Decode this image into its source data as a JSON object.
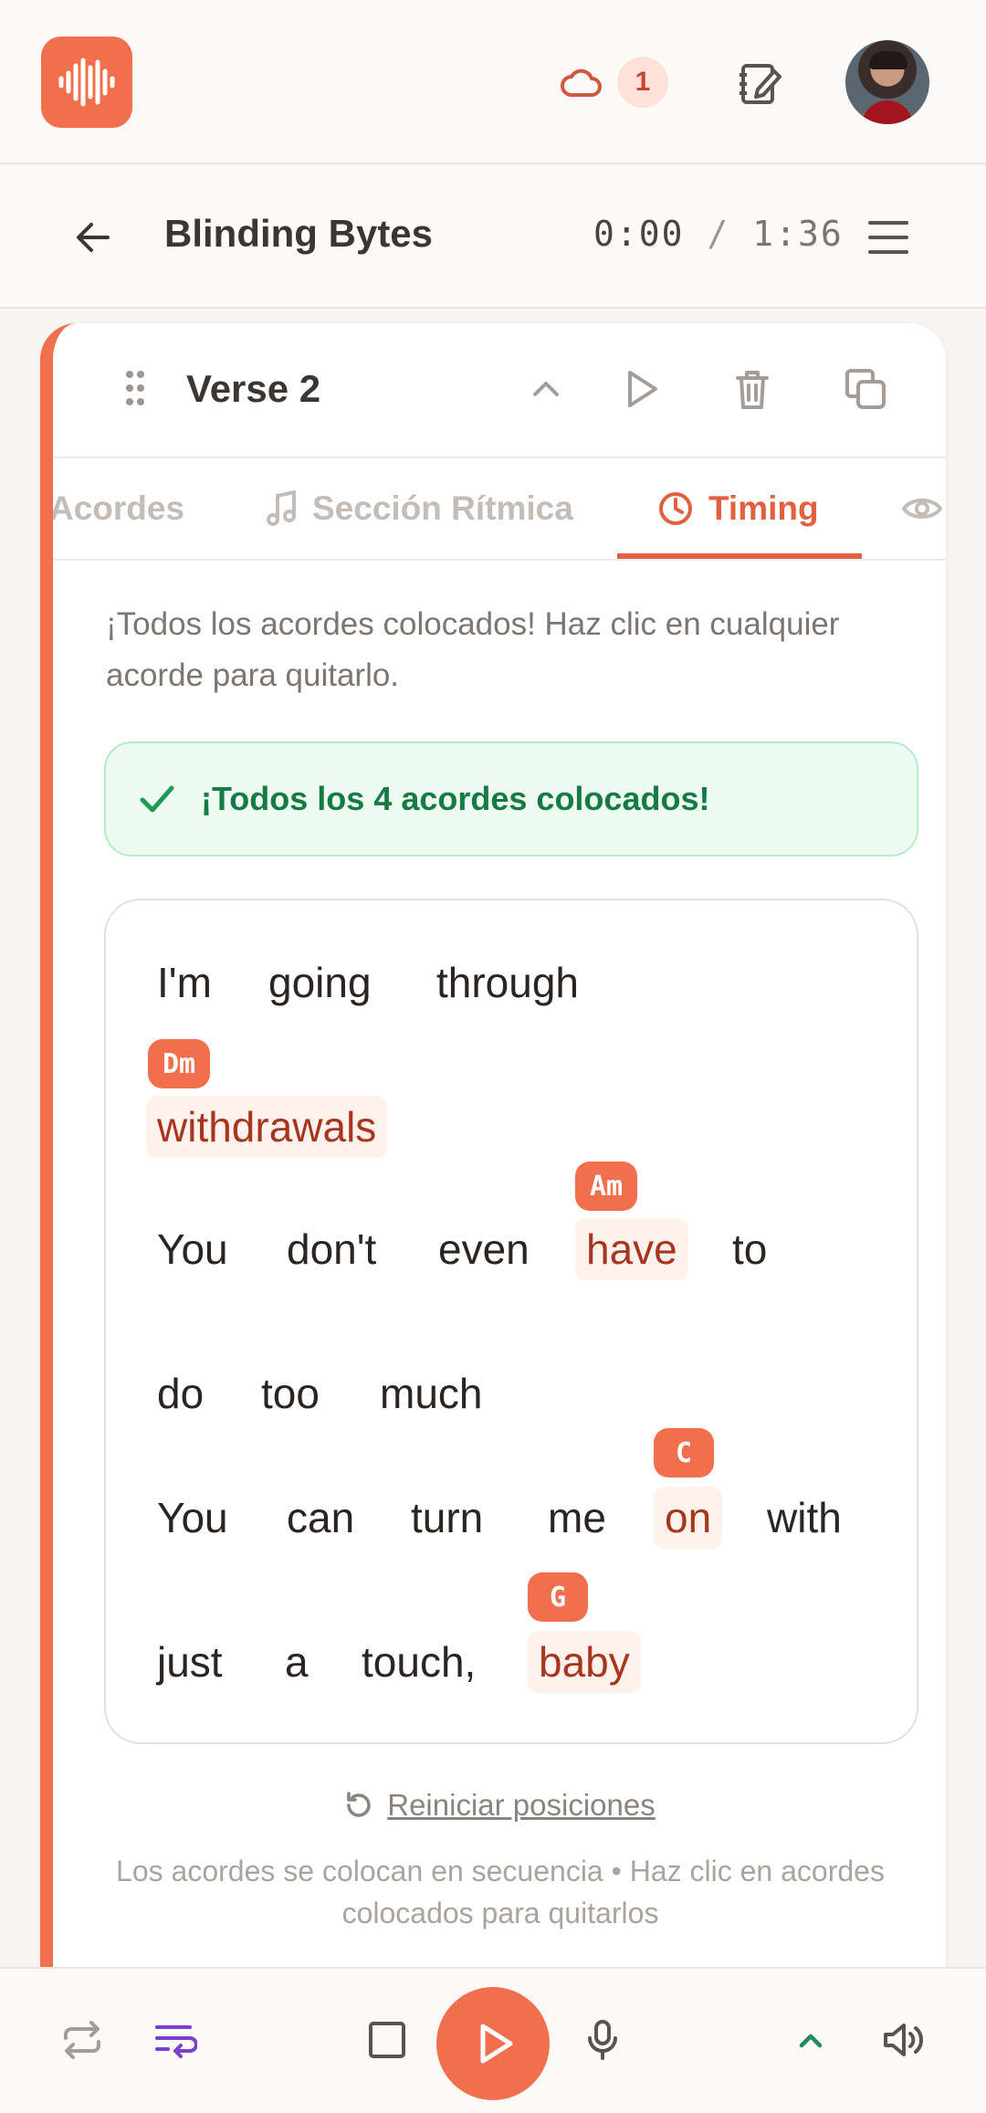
{
  "topbar": {
    "sync_count": "1"
  },
  "song": {
    "title": "Blinding Bytes",
    "current_time": "0:00",
    "separator": "/",
    "total_time": "1:36"
  },
  "section": {
    "name": "Verse 2"
  },
  "tabs": [
    {
      "label": "Acordes"
    },
    {
      "label": "Sección Rítmica"
    },
    {
      "label": "Timing"
    }
  ],
  "timing": {
    "instructions": "¡Todos los acordes colocados! Haz clic en cualquier acorde para quitarlo.",
    "success_message": "¡Todos los 4 acordes colocados!",
    "lines": [
      {
        "words": [
          "I'm",
          "going",
          "through"
        ]
      },
      {
        "words": [
          "withdrawals"
        ],
        "chord": "Dm"
      },
      {
        "words": [
          "You",
          "don't",
          "even",
          "have",
          "to"
        ],
        "chord": "Am"
      },
      {
        "words": [
          "do",
          "too",
          "much"
        ]
      },
      {
        "words": [
          "You",
          "can",
          "turn",
          "me",
          "on",
          "with"
        ],
        "chord": "C"
      },
      {
        "words": [
          "just",
          "a",
          "touch,",
          "baby"
        ],
        "chord": "G"
      }
    ],
    "reset_label": "Reiniciar posiciones",
    "hint": "Los acordes se colocan en secuencia • Haz clic en acordes colocados para quitarlos"
  },
  "icons": {
    "logo": "waveform-icon",
    "cloud": "cloud-icon",
    "notes": "notebook-edit-icon",
    "back": "arrow-left-icon",
    "menu": "menu-icon",
    "drag": "drag-handle-icon",
    "player": [
      "repeat-icon",
      "playlist-icon",
      "stop-icon",
      "play-icon",
      "mic-icon",
      "chevron-up-icon",
      "volume-icon"
    ]
  },
  "colors": {
    "accent": "#f26f4e",
    "success_text": "#157a43",
    "success_bg": "#edfaf2",
    "chord_word_text": "#a6361d",
    "playlist_icon": "#7a3fd1",
    "chevron_up": "#1f8a5b"
  }
}
